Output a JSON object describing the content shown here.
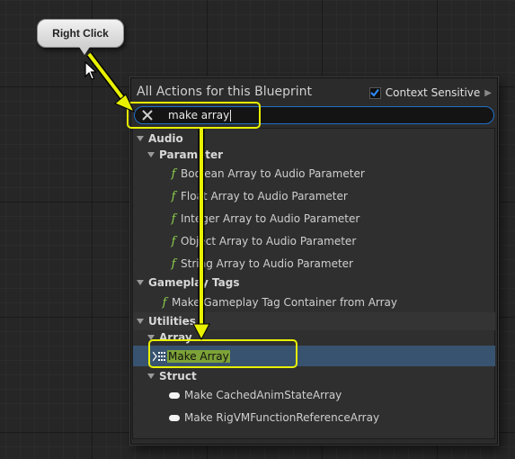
{
  "tooltip": {
    "text": "Right Click"
  },
  "menu": {
    "title": "All Actions for this Blueprint",
    "context_sensitive_label": "Context Sensitive",
    "context_sensitive_checked": true
  },
  "search": {
    "value": "make array"
  },
  "tree": {
    "audio": "Audio",
    "parameter": "Parameter",
    "audio_items": [
      "Boolean Array to Audio Parameter",
      "Float Array to Audio Parameter",
      "Integer Array to Audio Parameter",
      "Object Array to Audio Parameter",
      "String Array to Audio Parameter"
    ],
    "gameplay_tags": "Gameplay Tags",
    "gameplay_item": "Make Gameplay Tag Container from Array",
    "utilities": "Utilities",
    "array": "Array",
    "make_array": "Make Array",
    "struct": "Struct",
    "struct_items": [
      "Make CachedAnimStateArray",
      "Make RigVMFunctionReferenceArray"
    ]
  },
  "colors": {
    "highlight": "#e8f000",
    "selection": "#375370",
    "function_icon": "#8fd14f",
    "search_border": "#1f6fc7"
  }
}
